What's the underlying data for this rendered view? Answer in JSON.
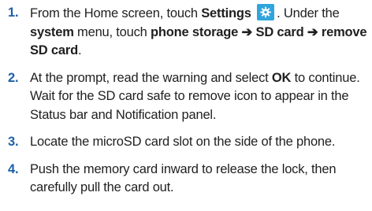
{
  "steps": [
    {
      "number": "1.",
      "parts": {
        "t1": "From the Home screen, touch ",
        "b1": "Settings",
        "t2": ". Under the ",
        "b2": "system",
        "t3": " menu, touch ",
        "b3": "phone storage ➔ SD card ➔ remove SD card",
        "t4": "."
      },
      "icon": "settings-gear-icon"
    },
    {
      "number": "2.",
      "parts": {
        "t1": "At the prompt, read the warning and select ",
        "b1": "OK",
        "t2": " to continue. Wait for the SD card safe to remove icon to appear in the Status bar and Notification panel."
      }
    },
    {
      "number": "3.",
      "text": "Locate the microSD card slot on the side of the phone."
    },
    {
      "number": "4.",
      "text": "Push the memory card inward to release the lock, then carefully pull the card out."
    }
  ],
  "colors": {
    "step_number": "#1f5fa8",
    "icon_background": "#2fa5dc",
    "text": "#1f1f1f"
  }
}
